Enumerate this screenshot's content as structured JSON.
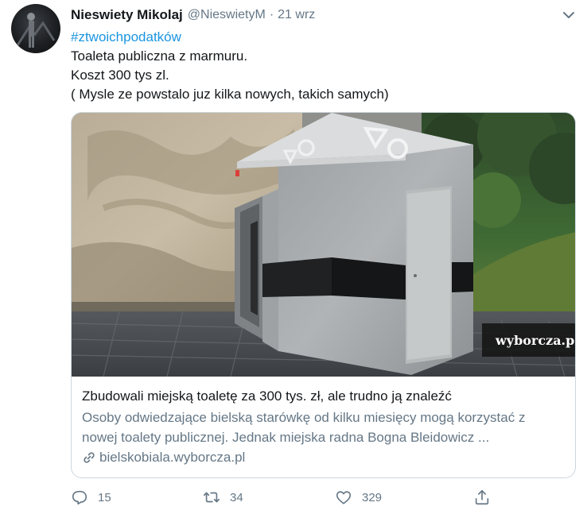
{
  "tweet": {
    "display_name": "Nieswiety Mikolaj",
    "handle": "@NieswietyM",
    "separator": "·",
    "date": "21 wrz",
    "hashtag": "#ztwoichpodatków",
    "lines": [
      "Toaleta publiczna z marmuru.",
      "Koszt 300 tys zl.",
      "( Mysle ze powstalo juz kilka nowych, takich samych)"
    ]
  },
  "card": {
    "image_badge": "wyborcza.pl",
    "title": "Zbudowali miejską toaletę za 300 tys. zł, ale trudno ją znaleźć",
    "description_lines": [
      "Osoby odwiedzające bielską starówkę od kilku miesięcy mogą korzystać z",
      "nowej toalety publicznej. Jednak miejska radna Bogna Bleidowicz ..."
    ],
    "link": "bielskobiala.wyborcza.pl"
  },
  "actions": {
    "reply_count": "15",
    "retweet_count": "34",
    "like_count": "329"
  },
  "icons": {
    "reply": "reply-icon",
    "retweet": "retweet-icon",
    "like": "heart-icon",
    "share": "share-icon",
    "more": "chevron-down-icon",
    "link": "link-icon"
  },
  "colors": {
    "hashtag": "#1b95e0",
    "secondary_text": "#657786",
    "brand_red": "#e0161c"
  }
}
